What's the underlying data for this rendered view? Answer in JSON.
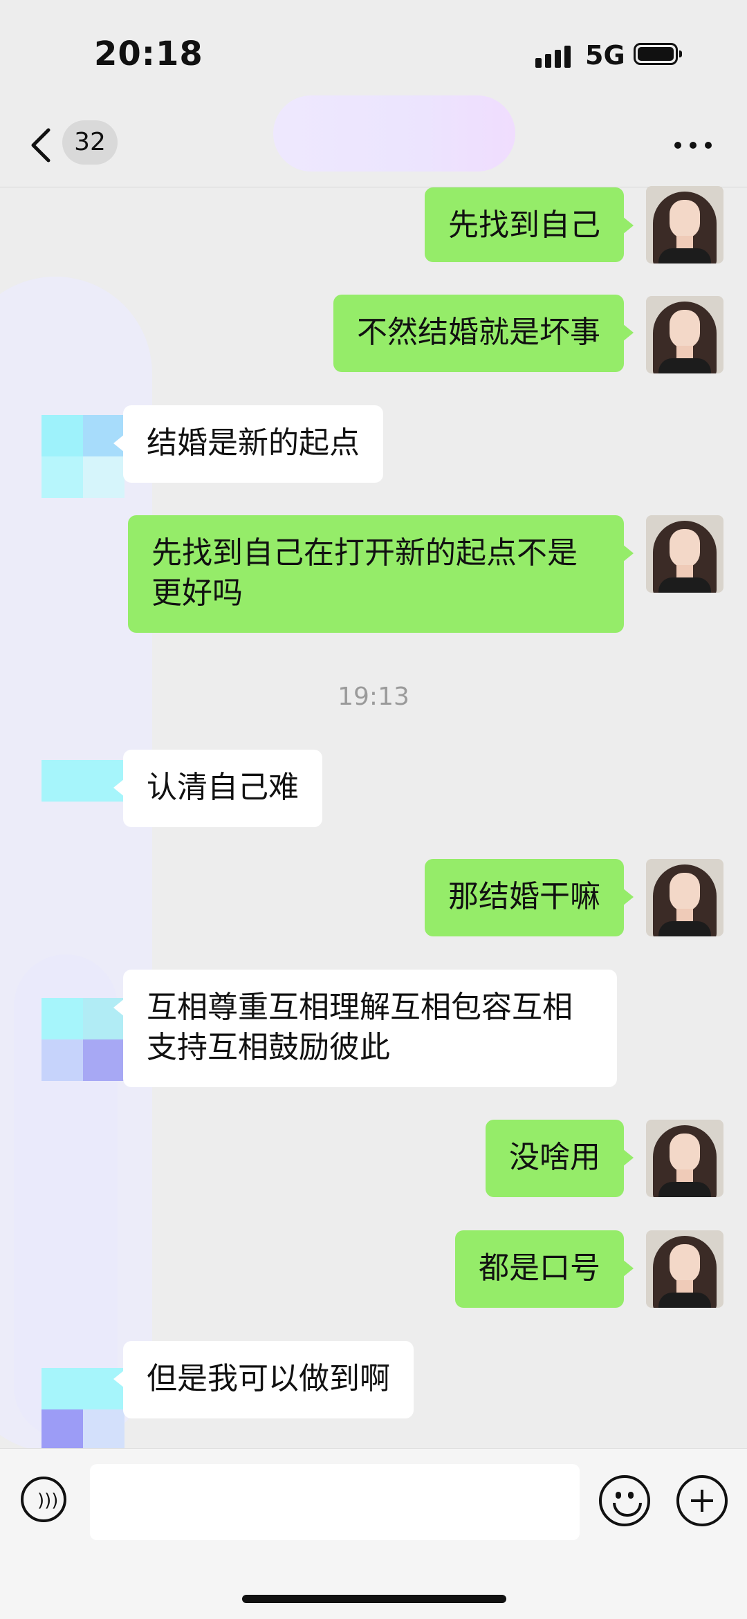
{
  "status_bar": {
    "time": "20:18",
    "network": "5G"
  },
  "header": {
    "unread_count": "32"
  },
  "messages": [
    {
      "sender": "self",
      "text": "先找到自己"
    },
    {
      "sender": "self",
      "text": "不然结婚就是坏事"
    },
    {
      "sender": "other",
      "text": "结婚是新的起点"
    },
    {
      "sender": "self",
      "text": "先找到自己在打开新的起点不是更好吗"
    },
    {
      "type": "timestamp",
      "text": "19:13"
    },
    {
      "sender": "other",
      "text": "认清自己难"
    },
    {
      "sender": "self",
      "text": "那结婚干嘛"
    },
    {
      "sender": "other",
      "text": "互相尊重互相理解互相包容互相支持互相鼓励彼此"
    },
    {
      "sender": "self",
      "text": "没啥用"
    },
    {
      "sender": "self",
      "text": "都是口号"
    },
    {
      "sender": "other",
      "text": "但是我可以做到啊"
    }
  ],
  "input": {
    "value": "",
    "placeholder": ""
  },
  "icons": {
    "back": "chevron-left-icon",
    "more": "more-dots-icon",
    "voice": "voice-icon",
    "emoji": "emoji-icon",
    "plus": "plus-icon"
  },
  "colors": {
    "self_bubble": "#95ec69",
    "other_bubble": "#ffffff",
    "background": "#ededed",
    "timestamp_text": "#9a9a9a"
  }
}
